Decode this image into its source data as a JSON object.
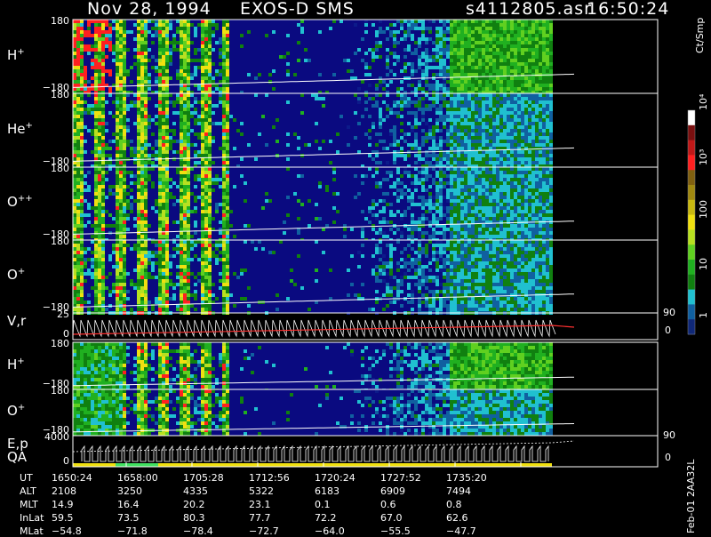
{
  "header": {
    "date": "Nov 28, 1994",
    "instrument": "EXOS-D SMS",
    "file": "s4112805.asr",
    "time": "16:50:24"
  },
  "panels": [
    {
      "label": "H",
      "sup": "+",
      "top_tick": "180",
      "bottom_tick": "−180"
    },
    {
      "label": "He",
      "sup": "+",
      "top_tick": "180",
      "bottom_tick": "−180"
    },
    {
      "label": "O",
      "sup": "++",
      "top_tick": "180",
      "bottom_tick": "−180"
    },
    {
      "label": "O",
      "sup": "+",
      "top_tick": "180",
      "bottom_tick": "−180"
    },
    {
      "label": "V,r",
      "sup": "",
      "top_tick": "25",
      "bottom_tick": "0",
      "right_top": "90",
      "right_bottom": "0"
    },
    {
      "label": "H",
      "sup": "+",
      "top_tick": "180",
      "bottom_tick": "−180"
    },
    {
      "label": "O",
      "sup": "+",
      "top_tick": "180",
      "bottom_tick": "−180"
    },
    {
      "label": "E,p",
      "label2": "QA",
      "sup": "",
      "top_tick": "4000",
      "bottom_tick": "0",
      "right_top": "90",
      "right_bottom": "0"
    }
  ],
  "colorbar": {
    "unit": "Ct/Smp",
    "ticks": [
      "10⁴",
      "10³",
      "100",
      "10",
      "1"
    ],
    "colors": [
      "#ffffff",
      "#7a1010",
      "#c01818",
      "#ff2020",
      "#806010",
      "#a08810",
      "#c8b810",
      "#f0e010",
      "#b8e020",
      "#60d020",
      "#20b020",
      "#108010",
      "#20c0d0",
      "#1060a0",
      "#102878"
    ]
  },
  "side_note": "Feb-01 2AA32L",
  "ephemeris": {
    "labels": [
      "UT",
      "ALT",
      "MLT",
      "InLat",
      "MLat"
    ],
    "columns": [
      {
        "UT": "1650:24",
        "ALT": "2108",
        "MLT": "14.9",
        "InLat": "59.5",
        "MLat": "−54.8"
      },
      {
        "UT": "1658:00",
        "ALT": "3250",
        "MLT": "16.4",
        "InLat": "73.5",
        "MLat": "−71.8"
      },
      {
        "UT": "1705:28",
        "ALT": "4335",
        "MLT": "20.2",
        "InLat": "80.3",
        "MLat": "−78.4"
      },
      {
        "UT": "1712:56",
        "ALT": "5322",
        "MLT": "23.1",
        "InLat": "77.7",
        "MLat": "−72.7"
      },
      {
        "UT": "1720:24",
        "ALT": "6183",
        "MLT": "0.1",
        "InLat": "72.2",
        "MLat": "−64.0"
      },
      {
        "UT": "1727:52",
        "ALT": "6909",
        "MLT": "0.6",
        "InLat": "67.0",
        "MLat": "−55.5"
      },
      {
        "UT": "1735:20",
        "ALT": "7494",
        "MLT": "0.8",
        "InLat": "62.6",
        "MLat": "−47.7"
      }
    ]
  },
  "chart_data": {
    "type": "heatmap",
    "title": "Nov 28, 1994   EXOS-D SMS",
    "x_ticks": [
      "1650:24",
      "1658:00",
      "1705:28",
      "1712:56",
      "1720:24",
      "1727:52",
      "1735:20"
    ],
    "series": [
      {
        "name": "H+",
        "ylim": [
          -180,
          180
        ]
      },
      {
        "name": "He+",
        "ylim": [
          -180,
          180
        ]
      },
      {
        "name": "O++",
        "ylim": [
          -180,
          180
        ]
      },
      {
        "name": "O+",
        "ylim": [
          -180,
          180
        ]
      },
      {
        "name": "V,r",
        "ylim": [
          0,
          25
        ],
        "right_ylim": [
          0,
          90
        ]
      },
      {
        "name": "H+",
        "ylim": [
          -180,
          180
        ]
      },
      {
        "name": "O+",
        "ylim": [
          -180,
          180
        ]
      },
      {
        "name": "E,p",
        "ylim": [
          0,
          4000
        ],
        "right_ylim": [
          0,
          90
        ]
      }
    ],
    "colorbar_unit": "Ct/Smp"
  }
}
